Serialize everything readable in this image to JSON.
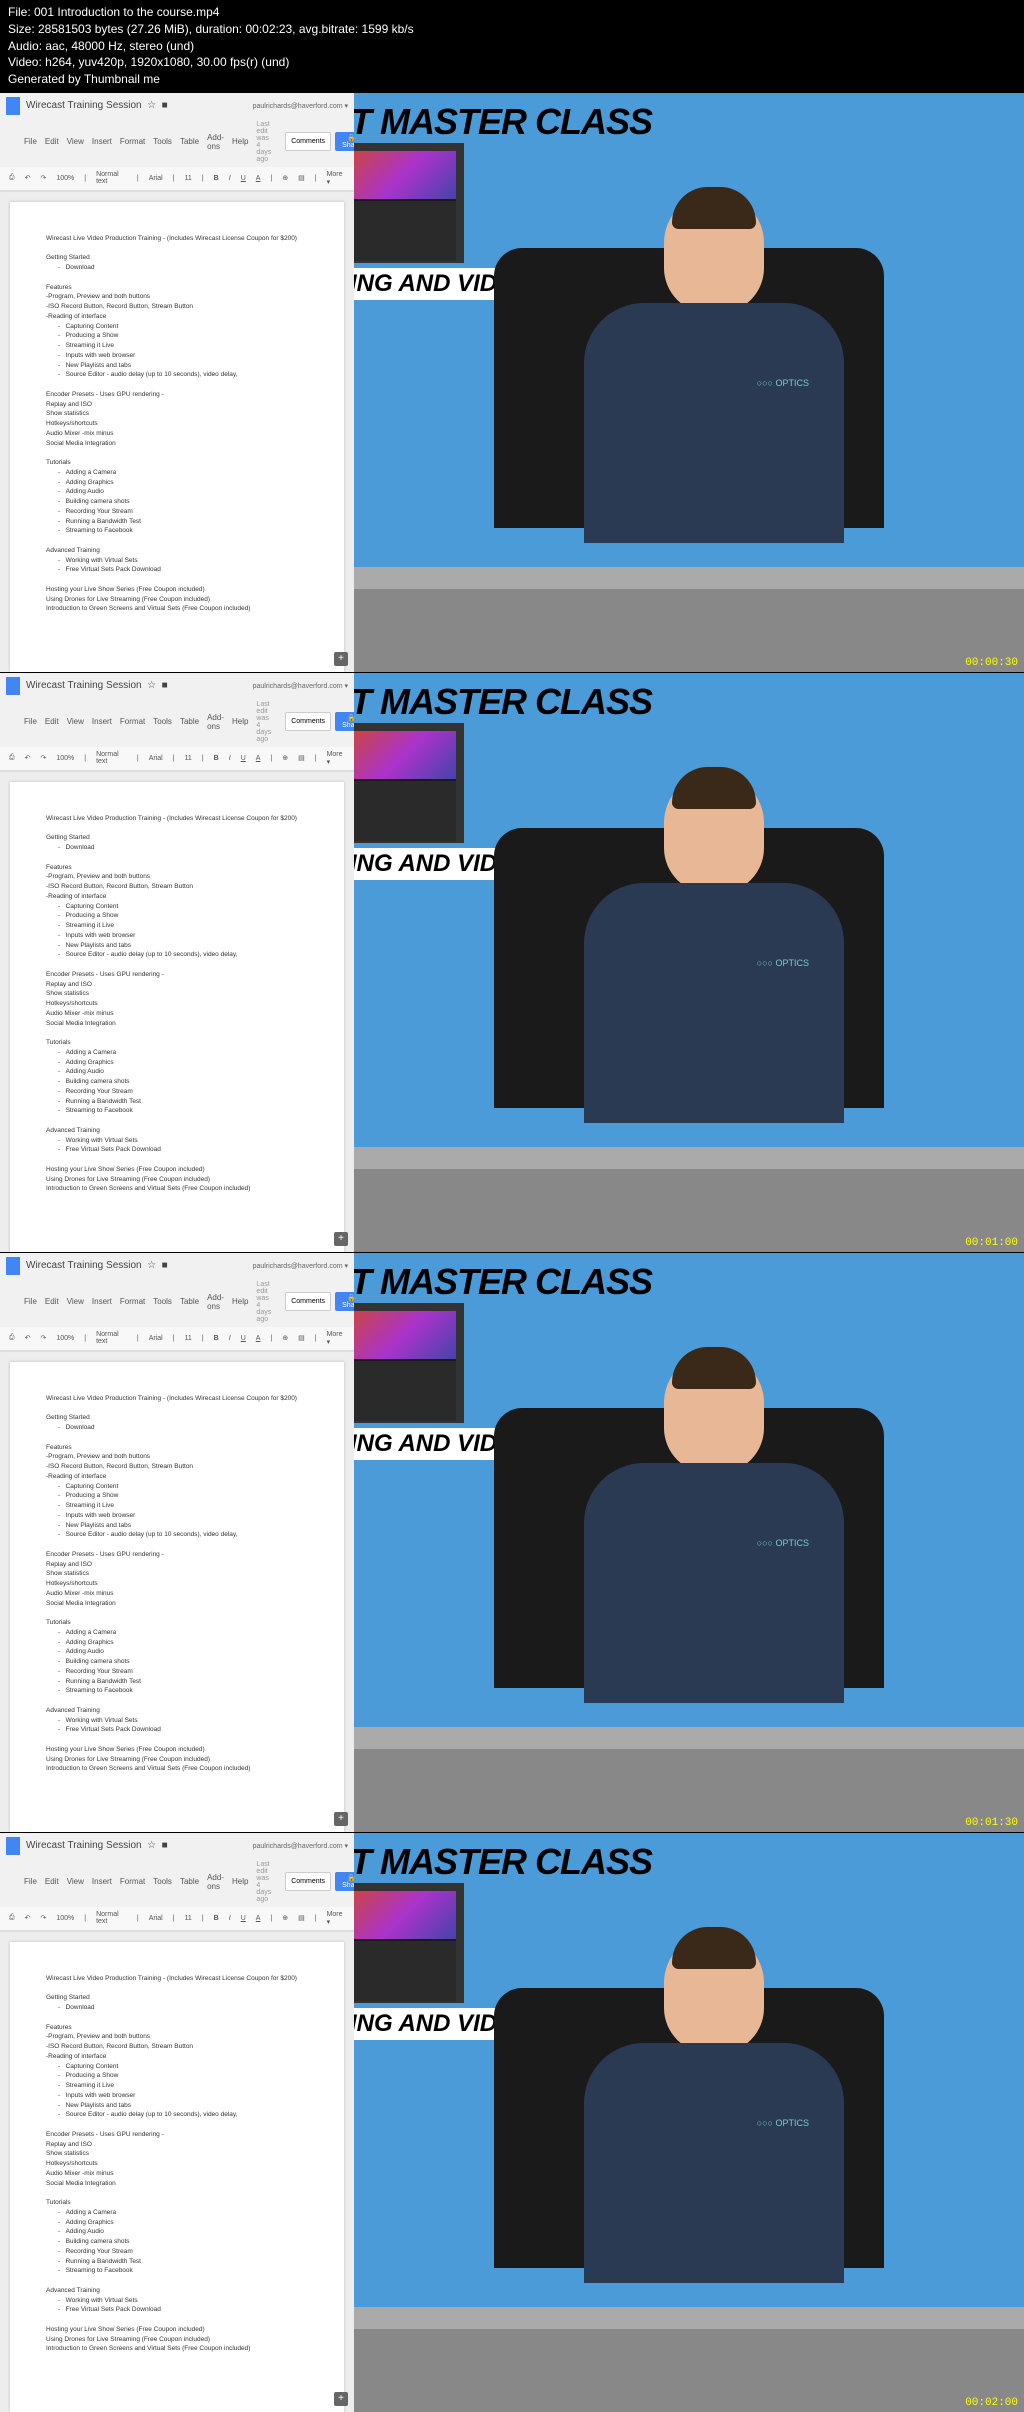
{
  "header": {
    "file": "File: 001 Introduction to the course.mp4",
    "size": "Size: 28581503 bytes (27.26 MiB), duration: 00:02:23, avg.bitrate: 1599 kb/s",
    "audio": "Audio: aac, 48000 Hz, stereo (und)",
    "video": "Video: h264, yuv420p, 1920x1080, 30.00 fps(r) (und)",
    "gen": "Generated by Thumbnail me"
  },
  "doc": {
    "title": "Wirecast Training Session",
    "user": "paulrichards@haverford.com",
    "menu": [
      "File",
      "Edit",
      "View",
      "Insert",
      "Format",
      "Tools",
      "Table",
      "Add-ons",
      "Help"
    ],
    "editInfo": "Last edit was 4 days ago",
    "comments": "Comments",
    "share": "Share",
    "toolbar": {
      "zoom": "100%",
      "style": "Normal text",
      "font": "Arial",
      "size": "11",
      "more": "More"
    },
    "content": {
      "heading": "Wirecast Live Video Production Training - (Includes Wirecast License Coupon for $200)",
      "s1": "Getting Started",
      "s1a": "Download",
      "s2": "Features",
      "s2a": "-Program, Preview and both buttons",
      "s2b": "-ISO Record Button, Record Button, Stream Button",
      "s2c": "-Reading of interface",
      "s2c1": "Capturing Content",
      "s2c2": "Producing a Show",
      "s2c3": "Streaming it Live",
      "s2c4": "Inputs with web browser",
      "s2c5": "New Playlists and tabs",
      "s2c6": "Source Editor - audio delay (up to 10 seconds), video delay,",
      "s3": "Encoder Presets - Uses GPU rendering -",
      "s3a": "Replay and ISO",
      "s3b": "Show statistics",
      "s3c": "Hotkeys/shortcuts",
      "s3d": "Audio Mixer -mix minus",
      "s3e": "Social Media Integration",
      "s4": "Tutorials",
      "s4a": "Adding a Camera",
      "s4b": "Adding Graphics",
      "s4c": "Adding Audio",
      "s4d": "Building camera shots",
      "s4e": "Recording Your Stream",
      "s4f": "Running a Bandwidth Test",
      "s4g": "Streaming to Facebook",
      "s5": "Advanced Training",
      "s5a": "Working with Virtual Sets",
      "s5b": "Free  Virtual Sets Pack Download",
      "s6a": "Hosting your Live Show Series (Free Coupon included)",
      "s6b": "Using Drones for Live Streaming (Free Coupon included)",
      "s6c": "Introduction to Green Screens and Virtual Sets (Free Coupon included)"
    }
  },
  "video": {
    "title": "T MASTER CLASS",
    "tag": "ING AND VID",
    "logo": "○○○ OPTICS"
  },
  "timestamps": [
    "00:00:30",
    "00:01:00",
    "00:01:30",
    "00:02:00"
  ]
}
